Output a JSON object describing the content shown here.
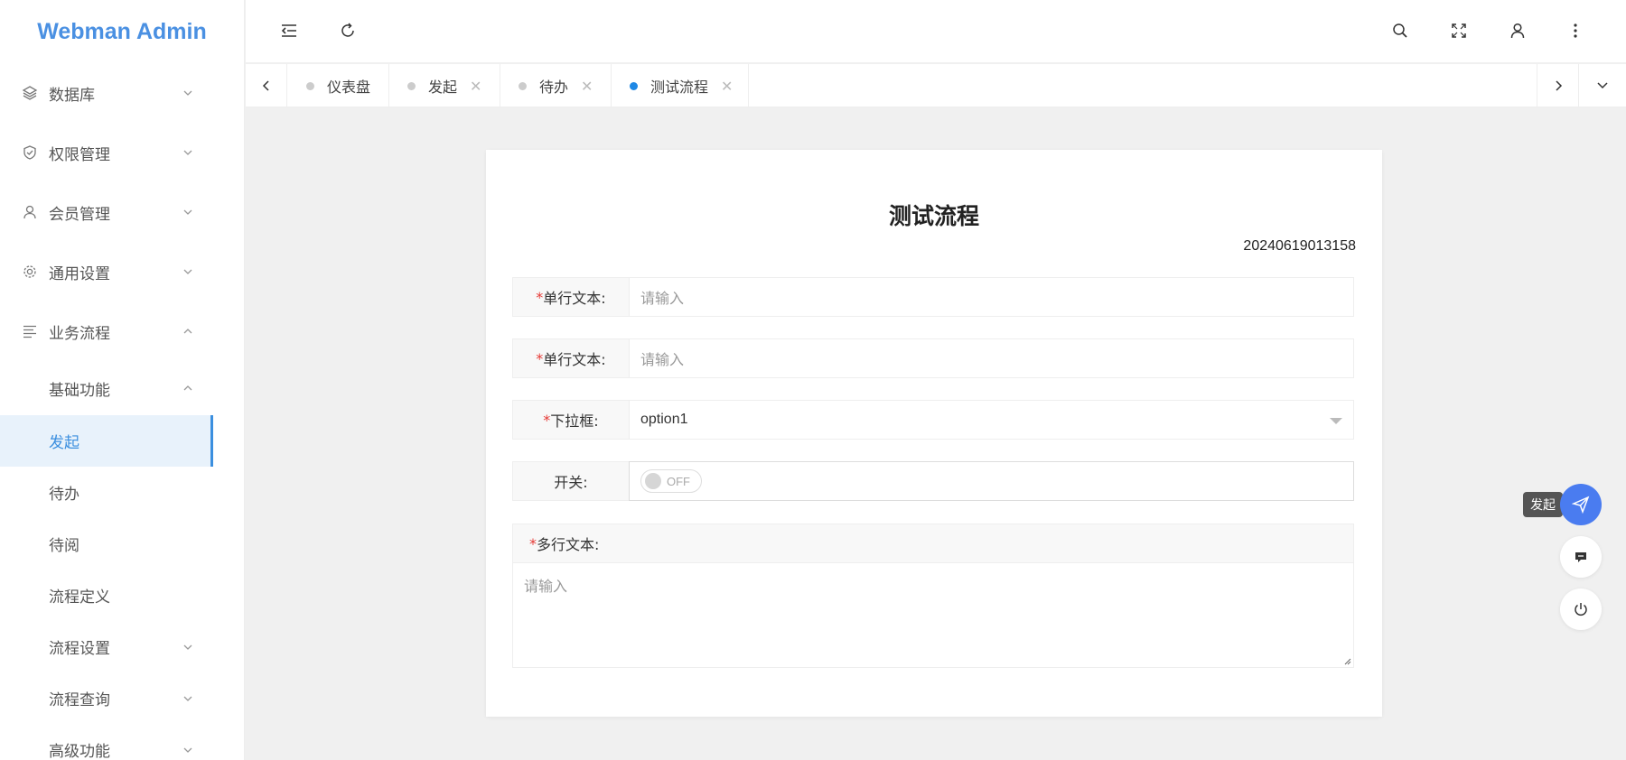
{
  "app": {
    "title": "Webman Admin"
  },
  "sidebar": {
    "items": [
      {
        "label": "数据库",
        "icon": "layers-icon",
        "expanded": false
      },
      {
        "label": "权限管理",
        "icon": "shield-icon",
        "expanded": false
      },
      {
        "label": "会员管理",
        "icon": "user-icon",
        "expanded": false
      },
      {
        "label": "通用设置",
        "icon": "gear-icon",
        "expanded": false
      },
      {
        "label": "业务流程",
        "icon": "list-icon",
        "expanded": true
      }
    ],
    "submenu": {
      "label": "基础功能",
      "expanded": true
    },
    "leaves": [
      {
        "label": "发起",
        "active": true
      },
      {
        "label": "待办"
      },
      {
        "label": "待阅"
      },
      {
        "label": "流程定义"
      },
      {
        "label": "流程设置",
        "has_children": true
      },
      {
        "label": "流程查询",
        "has_children": true
      },
      {
        "label": "高级功能",
        "has_children": true
      }
    ]
  },
  "header": {
    "icons": [
      "menu-fold-icon",
      "refresh-icon",
      "search-icon",
      "fullscreen-icon",
      "user-icon",
      "more-icon"
    ]
  },
  "tabs": [
    {
      "label": "仪表盘",
      "closable": false,
      "active": false
    },
    {
      "label": "发起",
      "closable": true,
      "active": false
    },
    {
      "label": "待办",
      "closable": true,
      "active": false
    },
    {
      "label": "测试流程",
      "closable": true,
      "active": true
    }
  ],
  "form": {
    "title": "测试流程",
    "number": "20240619013158",
    "fields": [
      {
        "label": "单行文本:",
        "required": true,
        "placeholder": "请输入"
      },
      {
        "label": "单行文本:",
        "required": true,
        "placeholder": "请输入"
      },
      {
        "label": "下拉框:",
        "required": true,
        "value": "option1"
      },
      {
        "label": "开关:",
        "required": false,
        "switch_text": "OFF"
      }
    ],
    "textarea": {
      "label": "多行文本:",
      "required": true,
      "placeholder": "请输入"
    }
  },
  "floating": {
    "tooltip": "发起"
  },
  "colors": {
    "accent": "#3b8fdf",
    "logo": "#4a90e2",
    "fab": "#4a7cf0",
    "required": "#e53935"
  }
}
